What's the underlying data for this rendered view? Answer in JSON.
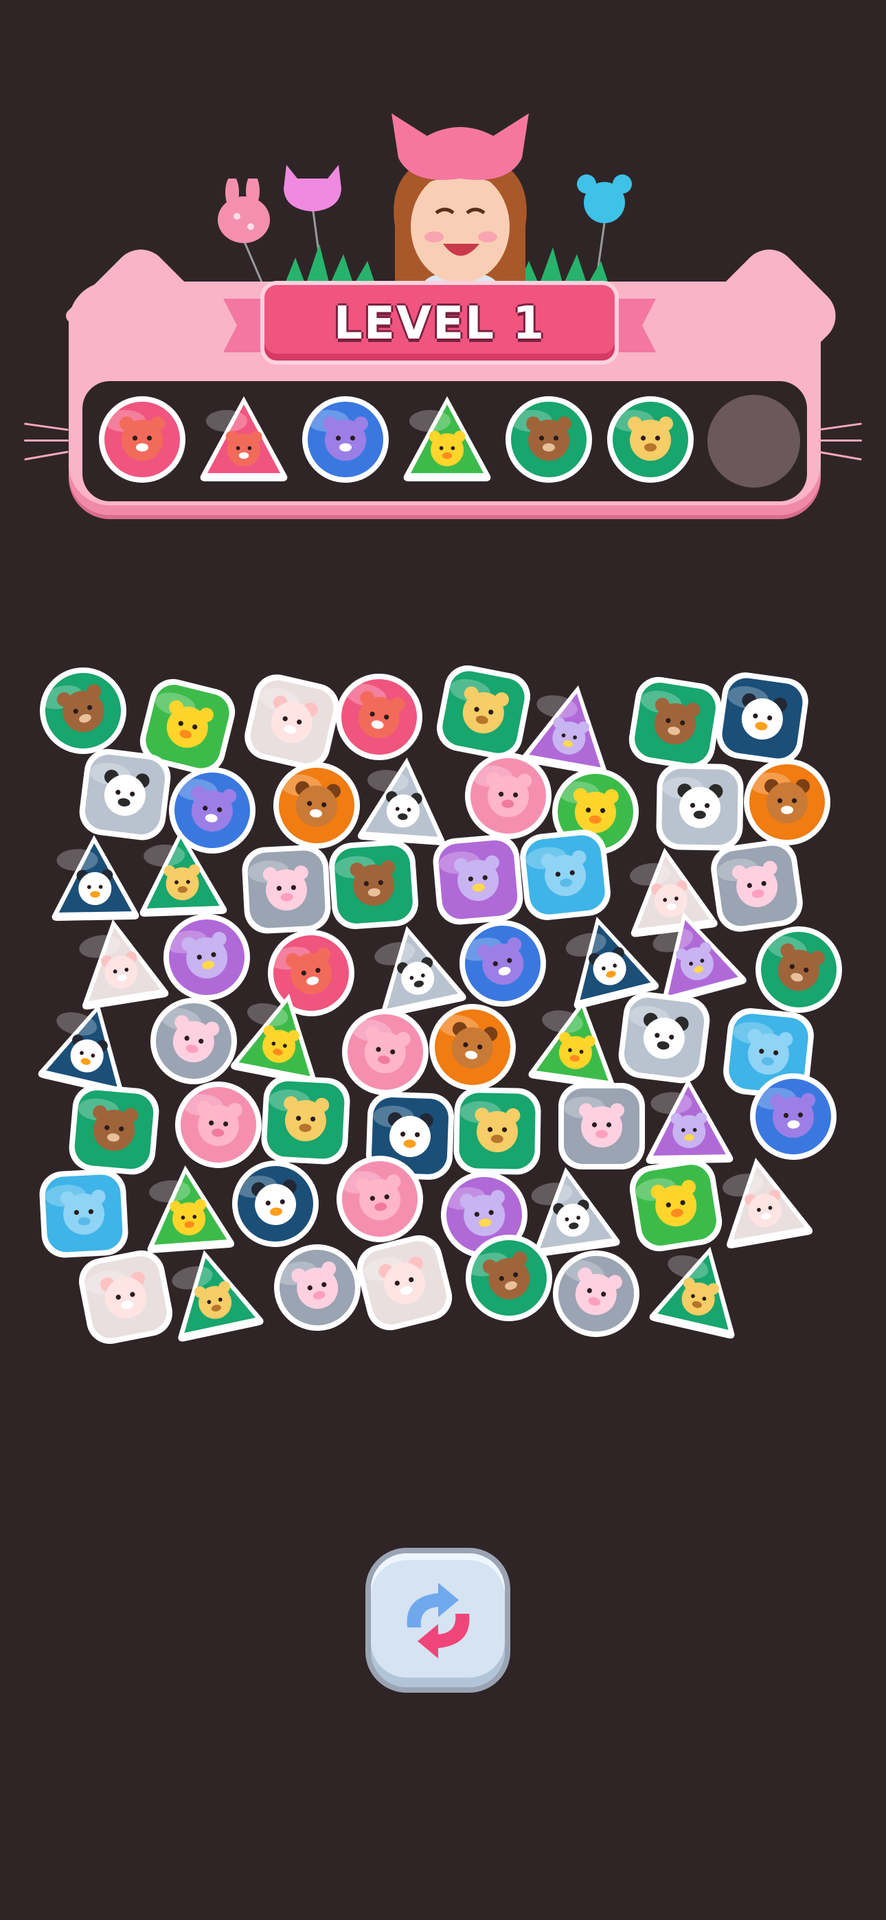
{
  "game": {
    "level_title": "LEVEL 1",
    "tray_slots_total": 7,
    "tray": [
      "fox",
      "fox",
      "owl",
      "chick",
      "bear",
      "giraffe",
      "empty"
    ],
    "shuffle_icon": "shuffle-arrows-icon"
  },
  "colors": {
    "background": "#2f2527",
    "panel_pink": "#f9b4c8",
    "ribbon_pink": "#f0557f",
    "empty_slot": "#6a585c"
  },
  "animals": {
    "fox": {
      "bg": "#f0557f",
      "face": "#f26b5a",
      "ear": "#f26b5a",
      "accent": "#ffffff"
    },
    "owl": {
      "bg": "#3a78e0",
      "face": "#9b7fe6",
      "ear": "#9b7fe6",
      "accent": "#ffffff"
    },
    "chick": {
      "bg": "#3dbb4a",
      "face": "#ffd52b",
      "ear": "#ffd52b",
      "accent": "#ff8a1f"
    },
    "bear": {
      "bg": "#18a56e",
      "face": "#a0643a",
      "ear": "#a0643a",
      "accent": "#e8c09a"
    },
    "giraffe": {
      "bg": "#18a56e",
      "face": "#f6cd66",
      "ear": "#f6cd66",
      "accent": "#b7742c"
    },
    "sheep": {
      "bg": "#eadfdf",
      "face": "#ffe4e4",
      "ear": "#ffc2c2",
      "accent": "#ffffff"
    },
    "pig": {
      "bg": "#f58fb0",
      "face": "#ffb6c8",
      "ear": "#ffb6c8",
      "accent": "#f07a9e"
    },
    "panda": {
      "bg": "#b9c3cf",
      "face": "#ffffff",
      "ear": "#2a2a2a",
      "accent": "#2a2a2a"
    },
    "penguin": {
      "bg": "#1b4f78",
      "face": "#ffffff",
      "ear": "#222833",
      "accent": "#ff9f1a"
    },
    "elephant": {
      "bg": "#3fb4e8",
      "face": "#8fd3f5",
      "ear": "#8fd3f5",
      "accent": "#5bbbe8"
    },
    "dog": {
      "bg": "#f07c12",
      "face": "#c97a36",
      "ear": "#7a3f16",
      "accent": "#ffffff"
    },
    "bunny": {
      "bg": "#9aa4b3",
      "face": "#ffd0e0",
      "ear": "#ffd0e0",
      "accent": "#ff9fc0"
    },
    "unicorn": {
      "bg": "#b06ad8",
      "face": "#c8b4f0",
      "ear": "#c8b4f0",
      "accent": "#ffd84d"
    }
  },
  "board": [
    {
      "animal": "bear",
      "shape": "circle"
    },
    {
      "animal": "chick",
      "shape": "rounded"
    },
    {
      "animal": "sheep",
      "shape": "rounded"
    },
    {
      "animal": "fox",
      "shape": "circle"
    },
    {
      "animal": "giraffe",
      "shape": "rounded"
    },
    {
      "animal": "unicorn",
      "shape": "triangle"
    },
    {
      "animal": "bear",
      "shape": "rounded"
    },
    {
      "animal": "penguin",
      "shape": "rounded"
    },
    {
      "animal": "panda",
      "shape": "rounded"
    },
    {
      "animal": "owl",
      "shape": "circle"
    },
    {
      "animal": "dog",
      "shape": "circle"
    },
    {
      "animal": "panda",
      "shape": "triangle"
    },
    {
      "animal": "pig",
      "shape": "circle"
    },
    {
      "animal": "chick",
      "shape": "circle"
    },
    {
      "animal": "panda",
      "shape": "rounded"
    },
    {
      "animal": "dog",
      "shape": "circle"
    },
    {
      "animal": "penguin",
      "shape": "triangle"
    },
    {
      "animal": "giraffe",
      "shape": "triangle"
    },
    {
      "animal": "bunny",
      "shape": "rounded"
    },
    {
      "animal": "bear",
      "shape": "rounded"
    },
    {
      "animal": "unicorn",
      "shape": "rounded"
    },
    {
      "animal": "elephant",
      "shape": "rounded"
    },
    {
      "animal": "sheep",
      "shape": "triangle"
    },
    {
      "animal": "bunny",
      "shape": "rounded"
    },
    {
      "animal": "sheep",
      "shape": "triangle"
    },
    {
      "animal": "unicorn",
      "shape": "circle"
    },
    {
      "animal": "fox",
      "shape": "circle"
    },
    {
      "animal": "panda",
      "shape": "triangle"
    },
    {
      "animal": "owl",
      "shape": "circle"
    },
    {
      "animal": "penguin",
      "shape": "triangle"
    },
    {
      "animal": "unicorn",
      "shape": "triangle"
    },
    {
      "animal": "bear",
      "shape": "circle"
    },
    {
      "animal": "penguin",
      "shape": "triangle"
    },
    {
      "animal": "bunny",
      "shape": "circle"
    },
    {
      "animal": "chick",
      "shape": "triangle"
    },
    {
      "animal": "pig",
      "shape": "circle"
    },
    {
      "animal": "dog",
      "shape": "circle"
    },
    {
      "animal": "chick",
      "shape": "triangle"
    },
    {
      "animal": "panda",
      "shape": "rounded"
    },
    {
      "animal": "elephant",
      "shape": "rounded"
    },
    {
      "animal": "bear",
      "shape": "rounded"
    },
    {
      "animal": "pig",
      "shape": "circle"
    },
    {
      "animal": "giraffe",
      "shape": "rounded"
    },
    {
      "animal": "penguin",
      "shape": "rounded"
    },
    {
      "animal": "giraffe",
      "shape": "rounded"
    },
    {
      "animal": "bunny",
      "shape": "rounded"
    },
    {
      "animal": "unicorn",
      "shape": "triangle"
    },
    {
      "animal": "owl",
      "shape": "circle"
    },
    {
      "animal": "elephant",
      "shape": "rounded"
    },
    {
      "animal": "chick",
      "shape": "triangle"
    },
    {
      "animal": "penguin",
      "shape": "circle"
    },
    {
      "animal": "pig",
      "shape": "circle"
    },
    {
      "animal": "unicorn",
      "shape": "circle"
    },
    {
      "animal": "panda",
      "shape": "triangle"
    },
    {
      "animal": "chick",
      "shape": "rounded"
    },
    {
      "animal": "sheep",
      "shape": "triangle"
    },
    {
      "animal": "sheep",
      "shape": "rounded"
    },
    {
      "animal": "giraffe",
      "shape": "triangle"
    },
    {
      "animal": "bunny",
      "shape": "circle"
    },
    {
      "animal": "sheep",
      "shape": "rounded"
    },
    {
      "animal": "bear",
      "shape": "circle"
    },
    {
      "animal": "bunny",
      "shape": "circle"
    },
    {
      "animal": "giraffe",
      "shape": "triangle"
    }
  ]
}
